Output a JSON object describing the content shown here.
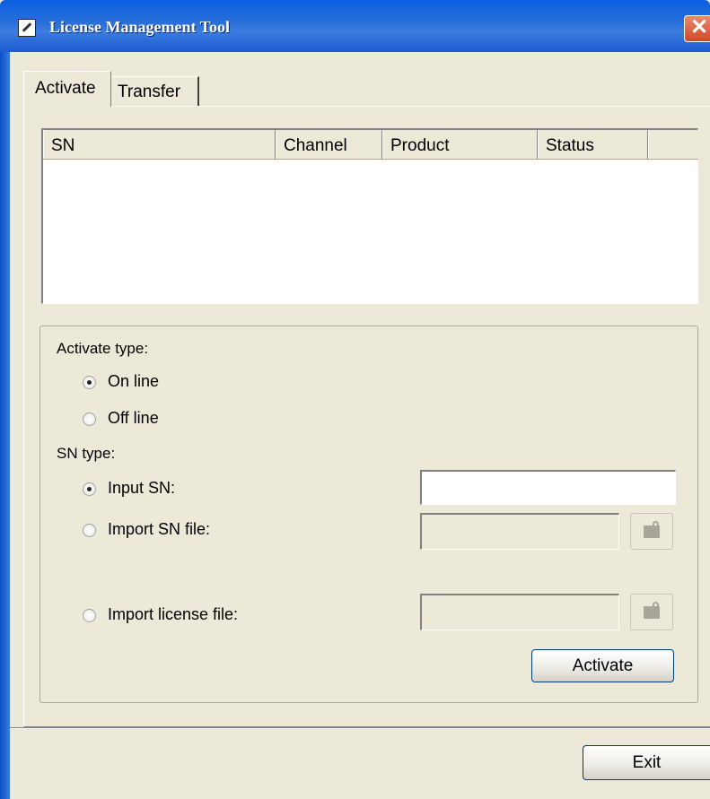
{
  "window": {
    "title": "License Management Tool",
    "close_glyph": "✕"
  },
  "tabs": [
    {
      "label": "Activate",
      "active": true
    },
    {
      "label": "Transfer",
      "active": false
    }
  ],
  "table": {
    "columns": [
      "SN",
      "Channel",
      "Product",
      "Status",
      ""
    ],
    "rows": []
  },
  "activate_type": {
    "label": "Activate type:",
    "options": [
      {
        "label": "On line",
        "checked": true
      },
      {
        "label": "Off line",
        "checked": false
      }
    ]
  },
  "sn_type": {
    "label": "SN type:",
    "options": [
      {
        "label": "Input SN:",
        "checked": true,
        "value": ""
      },
      {
        "label": "Import SN file:",
        "checked": false,
        "value": ""
      },
      {
        "label": "Import license file:",
        "checked": false,
        "value": ""
      }
    ]
  },
  "buttons": {
    "activate": "Activate",
    "exit": "Exit"
  },
  "icons": {
    "app": "app-logo-icon",
    "close": "close-icon",
    "browse": "folder-open-icon"
  }
}
